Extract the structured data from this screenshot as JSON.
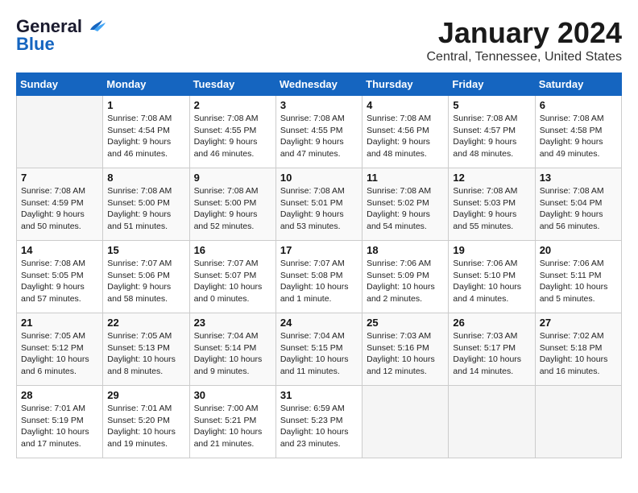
{
  "logo": {
    "line1": "General",
    "line2": "Blue"
  },
  "title": "January 2024",
  "subtitle": "Central, Tennessee, United States",
  "days_of_week": [
    "Sunday",
    "Monday",
    "Tuesday",
    "Wednesday",
    "Thursday",
    "Friday",
    "Saturday"
  ],
  "weeks": [
    [
      {
        "day": "",
        "info": ""
      },
      {
        "day": "1",
        "info": "Sunrise: 7:08 AM\nSunset: 4:54 PM\nDaylight: 9 hours\nand 46 minutes."
      },
      {
        "day": "2",
        "info": "Sunrise: 7:08 AM\nSunset: 4:55 PM\nDaylight: 9 hours\nand 46 minutes."
      },
      {
        "day": "3",
        "info": "Sunrise: 7:08 AM\nSunset: 4:55 PM\nDaylight: 9 hours\nand 47 minutes."
      },
      {
        "day": "4",
        "info": "Sunrise: 7:08 AM\nSunset: 4:56 PM\nDaylight: 9 hours\nand 48 minutes."
      },
      {
        "day": "5",
        "info": "Sunrise: 7:08 AM\nSunset: 4:57 PM\nDaylight: 9 hours\nand 48 minutes."
      },
      {
        "day": "6",
        "info": "Sunrise: 7:08 AM\nSunset: 4:58 PM\nDaylight: 9 hours\nand 49 minutes."
      }
    ],
    [
      {
        "day": "7",
        "info": "Sunrise: 7:08 AM\nSunset: 4:59 PM\nDaylight: 9 hours\nand 50 minutes."
      },
      {
        "day": "8",
        "info": "Sunrise: 7:08 AM\nSunset: 5:00 PM\nDaylight: 9 hours\nand 51 minutes."
      },
      {
        "day": "9",
        "info": "Sunrise: 7:08 AM\nSunset: 5:00 PM\nDaylight: 9 hours\nand 52 minutes."
      },
      {
        "day": "10",
        "info": "Sunrise: 7:08 AM\nSunset: 5:01 PM\nDaylight: 9 hours\nand 53 minutes."
      },
      {
        "day": "11",
        "info": "Sunrise: 7:08 AM\nSunset: 5:02 PM\nDaylight: 9 hours\nand 54 minutes."
      },
      {
        "day": "12",
        "info": "Sunrise: 7:08 AM\nSunset: 5:03 PM\nDaylight: 9 hours\nand 55 minutes."
      },
      {
        "day": "13",
        "info": "Sunrise: 7:08 AM\nSunset: 5:04 PM\nDaylight: 9 hours\nand 56 minutes."
      }
    ],
    [
      {
        "day": "14",
        "info": "Sunrise: 7:08 AM\nSunset: 5:05 PM\nDaylight: 9 hours\nand 57 minutes."
      },
      {
        "day": "15",
        "info": "Sunrise: 7:07 AM\nSunset: 5:06 PM\nDaylight: 9 hours\nand 58 minutes."
      },
      {
        "day": "16",
        "info": "Sunrise: 7:07 AM\nSunset: 5:07 PM\nDaylight: 10 hours\nand 0 minutes."
      },
      {
        "day": "17",
        "info": "Sunrise: 7:07 AM\nSunset: 5:08 PM\nDaylight: 10 hours\nand 1 minute."
      },
      {
        "day": "18",
        "info": "Sunrise: 7:06 AM\nSunset: 5:09 PM\nDaylight: 10 hours\nand 2 minutes."
      },
      {
        "day": "19",
        "info": "Sunrise: 7:06 AM\nSunset: 5:10 PM\nDaylight: 10 hours\nand 4 minutes."
      },
      {
        "day": "20",
        "info": "Sunrise: 7:06 AM\nSunset: 5:11 PM\nDaylight: 10 hours\nand 5 minutes."
      }
    ],
    [
      {
        "day": "21",
        "info": "Sunrise: 7:05 AM\nSunset: 5:12 PM\nDaylight: 10 hours\nand 6 minutes."
      },
      {
        "day": "22",
        "info": "Sunrise: 7:05 AM\nSunset: 5:13 PM\nDaylight: 10 hours\nand 8 minutes."
      },
      {
        "day": "23",
        "info": "Sunrise: 7:04 AM\nSunset: 5:14 PM\nDaylight: 10 hours\nand 9 minutes."
      },
      {
        "day": "24",
        "info": "Sunrise: 7:04 AM\nSunset: 5:15 PM\nDaylight: 10 hours\nand 11 minutes."
      },
      {
        "day": "25",
        "info": "Sunrise: 7:03 AM\nSunset: 5:16 PM\nDaylight: 10 hours\nand 12 minutes."
      },
      {
        "day": "26",
        "info": "Sunrise: 7:03 AM\nSunset: 5:17 PM\nDaylight: 10 hours\nand 14 minutes."
      },
      {
        "day": "27",
        "info": "Sunrise: 7:02 AM\nSunset: 5:18 PM\nDaylight: 10 hours\nand 16 minutes."
      }
    ],
    [
      {
        "day": "28",
        "info": "Sunrise: 7:01 AM\nSunset: 5:19 PM\nDaylight: 10 hours\nand 17 minutes."
      },
      {
        "day": "29",
        "info": "Sunrise: 7:01 AM\nSunset: 5:20 PM\nDaylight: 10 hours\nand 19 minutes."
      },
      {
        "day": "30",
        "info": "Sunrise: 7:00 AM\nSunset: 5:21 PM\nDaylight: 10 hours\nand 21 minutes."
      },
      {
        "day": "31",
        "info": "Sunrise: 6:59 AM\nSunset: 5:23 PM\nDaylight: 10 hours\nand 23 minutes."
      },
      {
        "day": "",
        "info": ""
      },
      {
        "day": "",
        "info": ""
      },
      {
        "day": "",
        "info": ""
      }
    ]
  ]
}
